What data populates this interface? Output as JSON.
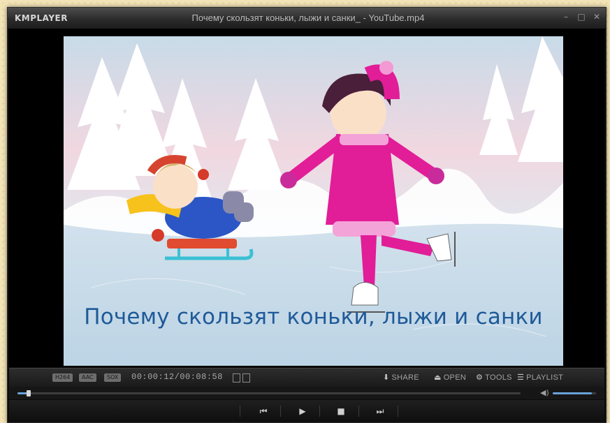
{
  "window": {
    "logo": "KMPLAYER",
    "title": "Почему скользят коньки, лыжи и санки_ - YouTube.mp4",
    "controls": [
      "minimize-icon",
      "maximize-icon",
      "close-icon"
    ]
  },
  "video": {
    "subtitle": "Почему скользят коньки, лыжи и санки"
  },
  "infobar": {
    "tags": [
      "H264",
      "AAC",
      "SOX"
    ],
    "time": "00:00:12/00:08:58",
    "menu": [
      {
        "icon": "download-icon",
        "label": "SHARE"
      },
      {
        "icon": "eject-icon",
        "label": "OPEN"
      },
      {
        "icon": "gear-icon",
        "label": "TOOLS"
      },
      {
        "icon": "list-icon",
        "label": "PLAYLIST"
      }
    ]
  },
  "seek": {
    "progress": 0.022,
    "volume": 0.9
  },
  "colors": {
    "accent": "#6aa2d8",
    "subtitle": "#1f5a98",
    "desktop": "#f3e4b8"
  }
}
